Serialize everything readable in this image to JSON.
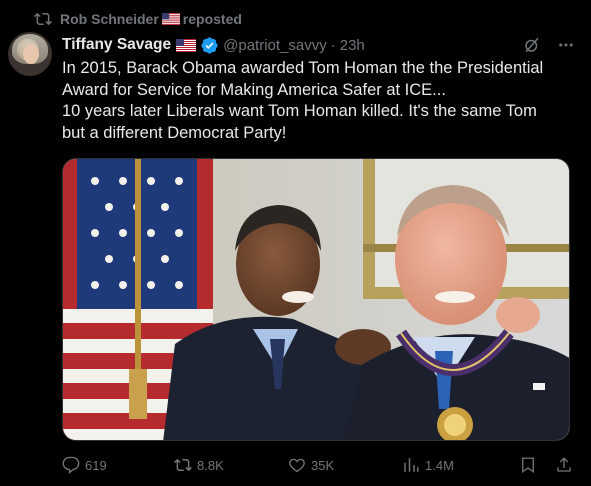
{
  "repost": {
    "author": "Rob Schneider",
    "label": "reposted"
  },
  "tweet": {
    "name": "Tiffany Savage",
    "handle": "@patriot_savvy",
    "separator": "·",
    "time": "23h",
    "lines": [
      "In 2015, Barack Obama awarded Tom Homan the the Presidential",
      "Award for Service for Making America Safer at ICE...",
      "10 years later Liberals want Tom Homan killed. It's the same Tom",
      "but a different Democrat Party!"
    ]
  },
  "stats": {
    "replies": "619",
    "reposts": "8.8K",
    "likes": "35K",
    "views": "1.4M"
  },
  "icons": {
    "repost": "repost-icon",
    "verified": "verified-badge-icon",
    "flag": "us-flag-icon",
    "grok": "grok-icon",
    "more": "more-icon",
    "reply": "reply-icon",
    "like": "heart-icon",
    "views": "views-chart-icon",
    "bookmark": "bookmark-icon",
    "share": "share-icon"
  },
  "colors": {
    "background": "#000000",
    "text": "#e7e9ea",
    "muted": "#71767b",
    "verified": "#1d9bf0"
  }
}
